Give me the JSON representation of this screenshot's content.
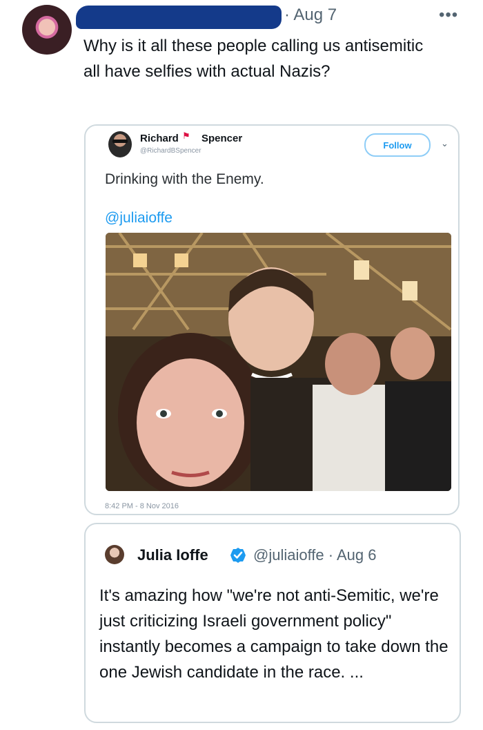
{
  "tweet": {
    "date": "· Aug 7",
    "more_icon": "more-icon",
    "text": "Why is it all these people calling us antisemitic all have selfies with actual Nazis?"
  },
  "quoted_1": {
    "name_first": "Richard",
    "name_last": "Spencer",
    "handle": "@RichardBSpencer",
    "follow_label": "Follow",
    "text": "Drinking with the Enemy.",
    "mention": "@juliaioffe",
    "timestamp": "8:42 PM - 8 Nov 2016"
  },
  "quoted_2": {
    "name": "Julia Ioffe",
    "meta": "@juliaioffe · Aug 6",
    "text": "It's amazing how \"we're not anti-Semitic, we're just criticizing Israeli government policy\" instantly becomes a campaign to take down the one Jewish candidate in the race. ...",
    "verified_color": "#1d9bf0"
  }
}
